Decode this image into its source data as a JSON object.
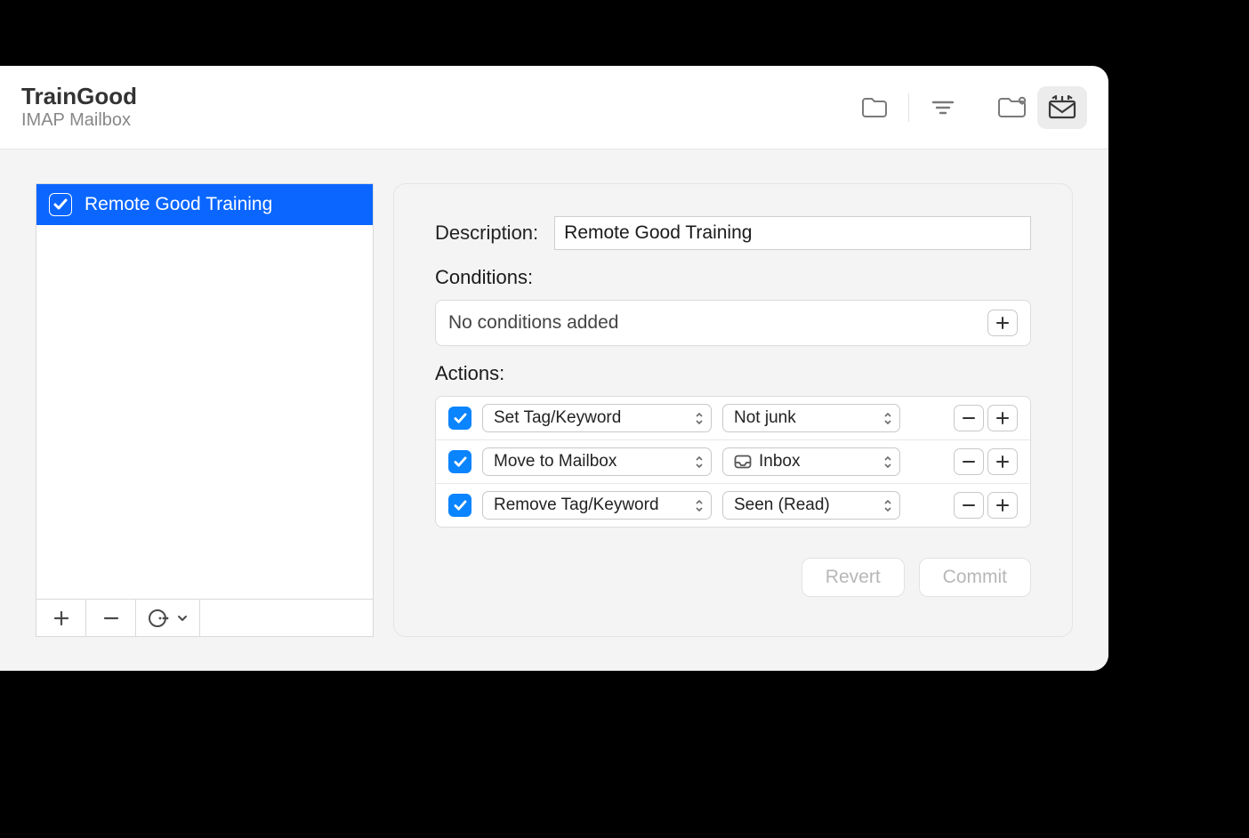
{
  "header": {
    "title": "TrainGood",
    "subtitle": "IMAP Mailbox"
  },
  "rules": {
    "items": [
      {
        "name": "Remote Good Training",
        "enabled": true,
        "selected": true
      }
    ]
  },
  "detail": {
    "description_label": "Description:",
    "description_value": "Remote Good Training",
    "conditions_label": "Conditions:",
    "conditions_placeholder": "No conditions added",
    "actions_label": "Actions:",
    "actions": [
      {
        "enabled": true,
        "type": "Set Tag/Keyword",
        "value": "Not junk",
        "value_icon": null
      },
      {
        "enabled": true,
        "type": "Move to Mailbox",
        "value": "Inbox",
        "value_icon": "inbox"
      },
      {
        "enabled": true,
        "type": "Remove Tag/Keyword",
        "value": "Seen (Read)",
        "value_icon": null
      }
    ],
    "revert_label": "Revert",
    "commit_label": "Commit"
  }
}
